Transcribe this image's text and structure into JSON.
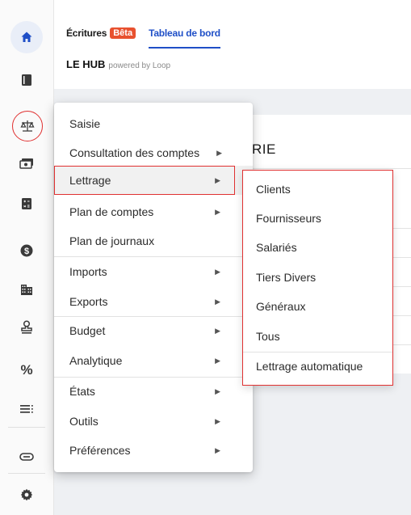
{
  "header": {
    "tab_ecritures": "Écritures",
    "beta_badge": "Bêta",
    "tab_dashboard": "Tableau de bord",
    "brand_name": "LE HUB",
    "brand_tagline": "powered by Loop"
  },
  "background_card": {
    "title_fragment": "RIE"
  },
  "rail": [
    {
      "icon": "home-icon",
      "glyph": "🏠"
    },
    {
      "icon": "book-icon",
      "glyph": "▮"
    },
    {
      "icon": "scale-icon",
      "glyph": "⚖"
    },
    {
      "icon": "cash-icon",
      "glyph": "▬"
    },
    {
      "icon": "calculator-icon",
      "glyph": "▦"
    },
    {
      "icon": "dollar-icon",
      "glyph": "$"
    },
    {
      "icon": "building-icon",
      "glyph": "▥"
    },
    {
      "icon": "stamp-icon",
      "glyph": "♙"
    },
    {
      "icon": "percent-icon",
      "glyph": "%"
    },
    {
      "icon": "list-icon",
      "glyph": "≡"
    },
    {
      "icon": "link-icon",
      "glyph": "⊖"
    },
    {
      "icon": "settings-icon",
      "glyph": "⚙"
    }
  ],
  "menu": {
    "items": [
      {
        "label": "Saisie",
        "has_submenu": false
      },
      {
        "label": "Consultation des comptes",
        "has_submenu": true
      },
      {
        "label": "Lettrage",
        "has_submenu": true,
        "active": true
      },
      {
        "label": "Plan de comptes",
        "has_submenu": true
      },
      {
        "label": "Plan de journaux",
        "has_submenu": false
      },
      {
        "label": "Imports",
        "has_submenu": true
      },
      {
        "label": "Exports",
        "has_submenu": true
      },
      {
        "label": "Budget",
        "has_submenu": true
      },
      {
        "label": "Analytique",
        "has_submenu": true
      },
      {
        "label": "États",
        "has_submenu": true
      },
      {
        "label": "Outils",
        "has_submenu": true
      },
      {
        "label": "Préférences",
        "has_submenu": true
      }
    ],
    "arrow_glyph": "▶"
  },
  "submenu": {
    "items": [
      {
        "label": "Clients"
      },
      {
        "label": "Fournisseurs"
      },
      {
        "label": "Salariés"
      },
      {
        "label": "Tiers Divers"
      },
      {
        "label": "Généraux"
      },
      {
        "label": "Tous"
      },
      {
        "label": "Lettrage automatique"
      }
    ]
  },
  "colors": {
    "accent": "#1f4fc7",
    "beta": "#e8512f",
    "annotation_red": "#e03131",
    "content_bg": "#eef0f3"
  }
}
